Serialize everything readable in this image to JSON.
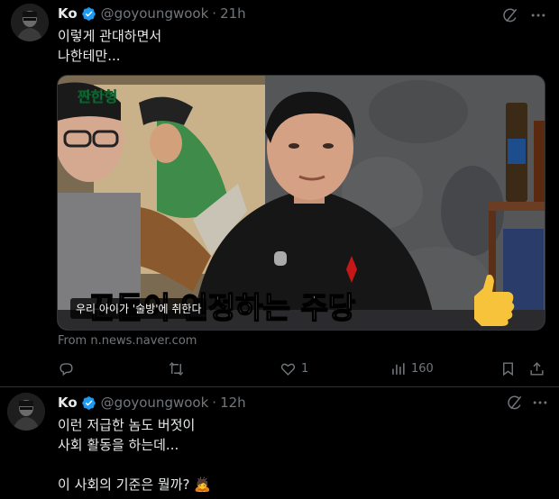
{
  "tweets": [
    {
      "name": "Ko",
      "handle": "@goyoungwook",
      "time": "21h",
      "lines": [
        "이렇게 관대하면서",
        "나한테만..."
      ],
      "media": {
        "show_title": "짠한형",
        "subtitle_small": "우리 아이가 '술방'에 취한다",
        "subtitle_large": "꾼들이 인정하는 주당"
      },
      "source": "From n.news.naver.com",
      "stats": {
        "replies": "",
        "reposts": "",
        "likes": "1",
        "views": "160"
      }
    },
    {
      "name": "Ko",
      "handle": "@goyoungwook",
      "time": "12h",
      "lines": [
        "이런 저급한 놈도 버젓이",
        "사회 활동을 하는데...",
        "",
        "이 사회의 기준은 뭘까? 🙇"
      ]
    }
  ],
  "colors": {
    "verified": "#1d9bf0",
    "muted": "#71767b",
    "text": "#e7e9ea",
    "border": "#2f3336"
  },
  "icons": [
    "reply-icon",
    "repost-icon",
    "like-icon",
    "views-icon",
    "bookmark-icon",
    "share-icon",
    "grok-icon",
    "more-icon",
    "verified-icon"
  ]
}
